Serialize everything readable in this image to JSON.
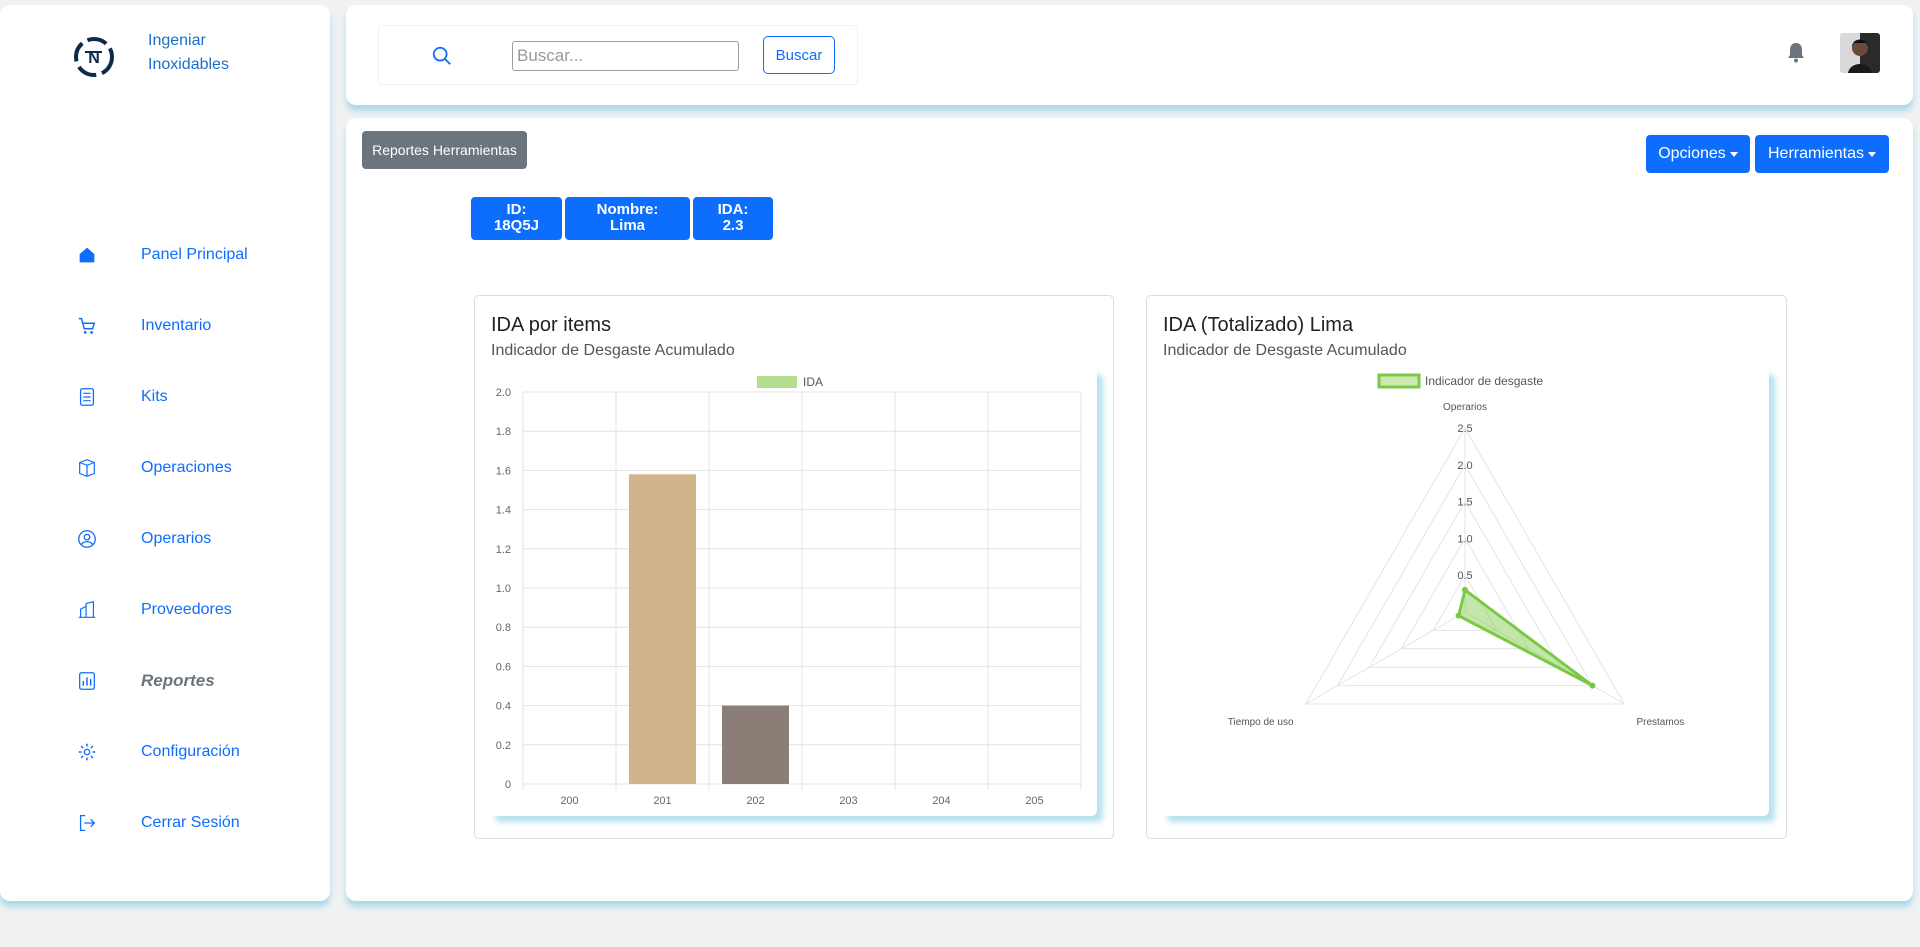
{
  "brand": {
    "name": "Ingeniar Inoxidables"
  },
  "sidebar": {
    "items": [
      {
        "label": "Panel Principal",
        "icon": "home-icon"
      },
      {
        "label": "Inventario",
        "icon": "cart-icon"
      },
      {
        "label": "Kits",
        "icon": "checklist-icon"
      },
      {
        "label": "Operaciones",
        "icon": "box-icon"
      },
      {
        "label": "Operarios",
        "icon": "user-circle-icon"
      },
      {
        "label": "Proveedores",
        "icon": "building-icon"
      },
      {
        "label": "Reportes",
        "icon": "bar-chart-icon",
        "active": true
      },
      {
        "label": "Configuración",
        "icon": "gear-icon"
      },
      {
        "label": "Cerrar Sesión",
        "icon": "logout-icon"
      }
    ]
  },
  "search": {
    "placeholder": "Buscar...",
    "value": "",
    "button_label": "Buscar"
  },
  "toolbar": {
    "report_label": "Reportes Herramientas",
    "options_label": "Opciones",
    "tools_label": "Herramientas"
  },
  "badges": [
    {
      "line1": "ID:",
      "line2": "18Q5J"
    },
    {
      "line1": "Nombre:",
      "line2": "Lima"
    },
    {
      "line1": "IDA:",
      "line2": "2.3"
    }
  ],
  "cards": [
    {
      "title": "IDA por items",
      "subtitle": "Indicador de Desgaste Acumulado"
    },
    {
      "title": "IDA (Totalizado) Lima",
      "subtitle": "Indicador de Desgaste Acumulado"
    }
  ],
  "colors": {
    "primary": "#0d6efd",
    "secondary": "#6c757d",
    "radar": "#7ac943"
  },
  "chart_data": [
    {
      "type": "bar",
      "categories": [
        "200",
        "201",
        "202",
        "203",
        "204",
        "205"
      ],
      "series": [
        {
          "name": "IDA",
          "values": [
            0,
            1.58,
            0.4,
            0,
            0,
            0
          ]
        }
      ],
      "bar_colors": [
        "#d2b48c",
        "#d2b48c",
        "#8b7e76",
        "#d2b48c",
        "#d2b48c",
        "#d2b48c"
      ],
      "legend_color": "#b5de8f",
      "ylim": [
        0,
        2.0
      ],
      "yticks": [
        "0",
        "0.2",
        "0.4",
        "0.6",
        "0.8",
        "1.0",
        "1.2",
        "1.4",
        "1.6",
        "1.8",
        "2.0"
      ],
      "grid": true,
      "legend": "top"
    },
    {
      "type": "radar",
      "axes": [
        "Operarios",
        "Prestamos",
        "Tiempo de uso"
      ],
      "series": [
        {
          "name": "Indicador de desgaste",
          "values": [
            0.3,
            2.0,
            0.1
          ]
        }
      ],
      "rlim": [
        0,
        2.5
      ],
      "rticks": [
        "0.5",
        "1.0",
        "1.5",
        "2.0",
        "2.5"
      ],
      "legend": "top"
    }
  ]
}
